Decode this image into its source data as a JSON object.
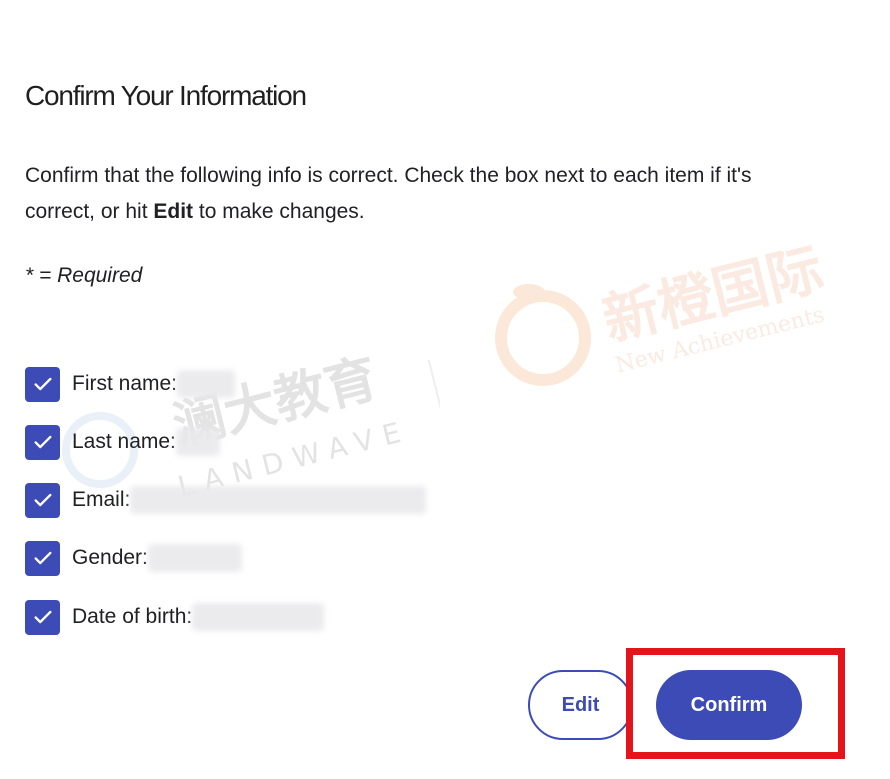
{
  "page": {
    "title": "Confirm Your Information",
    "description_before": "Confirm that the following info is correct. Check the box next to each item if it's correct, or hit ",
    "description_bold": "Edit",
    "description_after": " to make changes.",
    "required_note": "* = Required"
  },
  "fields": [
    {
      "label": "First name:",
      "checked": true
    },
    {
      "label": "Last name:",
      "checked": true
    },
    {
      "label": "Email:",
      "checked": true
    },
    {
      "label": "Gender:",
      "checked": true
    },
    {
      "label": "Date of birth:",
      "checked": true
    }
  ],
  "buttons": {
    "edit": "Edit",
    "confirm": "Confirm"
  },
  "watermarks": {
    "left_cn": "澜大教育",
    "left_en": "LANDWAVE",
    "right_cn": "新橙国际",
    "right_en": "New Achievements"
  },
  "colors": {
    "accent": "#3c4bb5",
    "highlight": "#e5141a"
  }
}
